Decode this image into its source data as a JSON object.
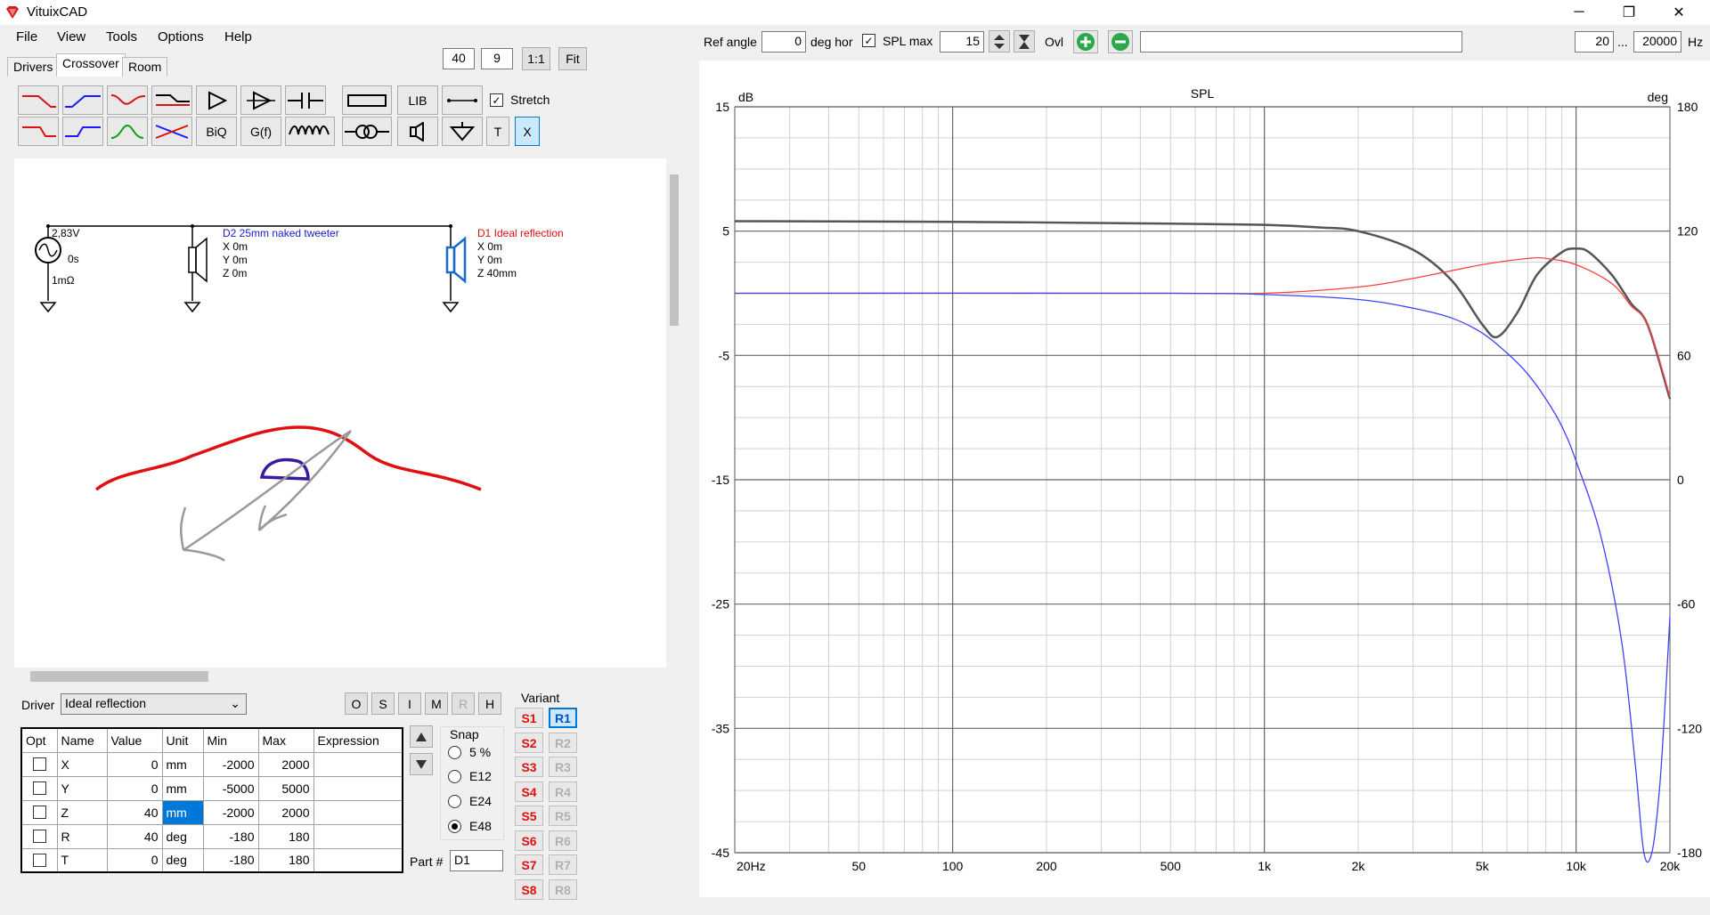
{
  "app": {
    "title": "VituixCAD"
  },
  "window": {
    "minimize": "─",
    "restore": "❐",
    "close": "✕"
  },
  "menu": [
    "File",
    "View",
    "Tools",
    "Options",
    "Help"
  ],
  "tabs": [
    "Drivers",
    "Crossover",
    "Room"
  ],
  "zoom": {
    "a": "40",
    "b": "9",
    "ratio": "1:1",
    "fit": "Fit"
  },
  "toolbar": {
    "lib": "LIB",
    "biq": "BiQ",
    "gf": "G(f)",
    "t": "T",
    "x": "X",
    "stretch": "Stretch"
  },
  "schematic": {
    "source": {
      "voltage": "2,83V",
      "delay": "0s",
      "impedance": "1mΩ"
    },
    "driver2": {
      "name": "D2 25mm naked tweeter",
      "x": "X 0m",
      "y": "Y 0m",
      "z": "Z 0m",
      "color": "#1a1acc"
    },
    "driver1": {
      "name": "D1 Ideal reflection",
      "x": "X 0m",
      "y": "Y 0m",
      "z": "Z 40mm",
      "color": "#e01010"
    }
  },
  "driver_panel": {
    "label": "Driver",
    "selected": "Ideal reflection",
    "buttons": [
      "O",
      "S",
      "I",
      "M",
      "R",
      "H"
    ]
  },
  "params": {
    "headers": [
      "Opt",
      "Name",
      "Value",
      "Unit",
      "Min",
      "Max",
      "Expression"
    ],
    "rows": [
      {
        "name": "X",
        "value": "0",
        "unit": "mm",
        "min": "-2000",
        "max": "2000"
      },
      {
        "name": "Y",
        "value": "0",
        "unit": "mm",
        "min": "-5000",
        "max": "5000"
      },
      {
        "name": "Z",
        "value": "40",
        "unit": "mm",
        "min": "-2000",
        "max": "2000"
      },
      {
        "name": "R",
        "value": "40",
        "unit": "deg",
        "min": "-180",
        "max": "180"
      },
      {
        "name": "T",
        "value": "0",
        "unit": "deg",
        "min": "-180",
        "max": "180"
      }
    ]
  },
  "snap": {
    "label": "Snap",
    "options": [
      "5 %",
      "E12",
      "E24",
      "E48"
    ],
    "selected": "E48"
  },
  "part": {
    "label": "Part #",
    "value": "D1"
  },
  "variant": {
    "label": "Variant",
    "s": [
      "S1",
      "S2",
      "S3",
      "S4",
      "S5",
      "S6",
      "S7",
      "S8"
    ],
    "r": [
      "R1",
      "R2",
      "R3",
      "R4",
      "R5",
      "R6",
      "R7",
      "R8"
    ],
    "active": "R1"
  },
  "right_toolbar": {
    "ref_angle_label": "Ref angle",
    "ref_angle": "0",
    "deg_hor": "deg hor",
    "spl_max_label": "SPL max",
    "spl_max": "15",
    "ovl": "Ovl",
    "fmin": "20",
    "dots": "...",
    "fmax": "20000",
    "hz": "Hz"
  },
  "chart_data": {
    "type": "line",
    "title": "SPL",
    "ylabel_left": "dB",
    "ylabel_right": "deg",
    "xscale": "log",
    "xlim": [
      20,
      20000
    ],
    "ylim": [
      -45,
      15
    ],
    "ylim_right": [
      -180,
      180
    ],
    "grid": true,
    "x_ticks": [
      "20Hz",
      "50",
      "100",
      "200",
      "500",
      "1k",
      "2k",
      "5k",
      "10k",
      "20k"
    ],
    "x_tick_values": [
      20,
      50,
      100,
      200,
      500,
      1000,
      2000,
      5000,
      10000,
      20000
    ],
    "y_ticks_left": [
      "15",
      "5",
      "-5",
      "-15",
      "-25",
      "-35",
      "-45"
    ],
    "y_ticks_right": [
      "180",
      "120",
      "60",
      "0",
      "-60",
      "-120",
      "-180"
    ],
    "series": [
      {
        "name": "",
        "color": "#555555",
        "x": [
          20,
          100,
          500,
          1000,
          1500,
          2000,
          3000,
          4000,
          5000,
          5600,
          6500,
          7500,
          9000,
          10000,
          11000,
          13000,
          15000,
          17000,
          20000
        ],
        "y": [
          5.8,
          5.75,
          5.6,
          5.5,
          5.3,
          5.0,
          3.5,
          1.0,
          -2.5,
          -3.5,
          -1.5,
          1.5,
          3.3,
          3.6,
          3.3,
          1.5,
          -0.8,
          -2.6,
          -8.5
        ]
      },
      {
        "name": "",
        "color": "#ff4040",
        "x": [
          20,
          500,
          1000,
          2000,
          3000,
          5000,
          7000,
          8000,
          10000,
          13000,
          15000,
          17000,
          20000
        ],
        "y": [
          0,
          0,
          0,
          0.5,
          1.2,
          2.3,
          2.8,
          2.8,
          2.3,
          0.8,
          -1.0,
          -2.6,
          -8.3
        ]
      },
      {
        "name": "",
        "color": "#4040ff",
        "x": [
          20,
          500,
          1000,
          2000,
          3000,
          4000,
          5000,
          6000,
          7000,
          8000,
          9000,
          10000,
          12000,
          14000,
          15500,
          16500,
          17500,
          18500,
          19300,
          20000
        ],
        "y": [
          0,
          0,
          -0.1,
          -0.5,
          -1.2,
          -2.0,
          -3.2,
          -4.8,
          -6.5,
          -8.5,
          -10.7,
          -13.5,
          -19.5,
          -28.0,
          -38,
          -45,
          -45,
          -40,
          -33,
          -26
        ]
      }
    ]
  }
}
